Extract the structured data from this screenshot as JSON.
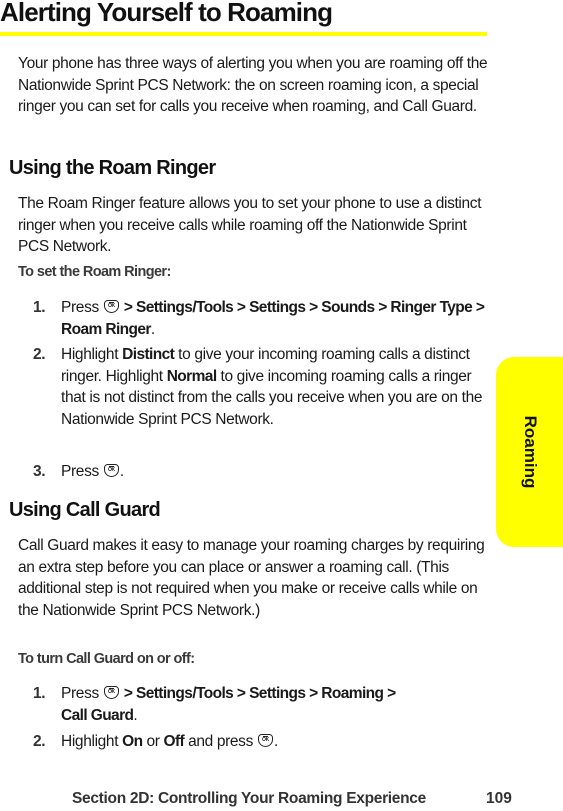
{
  "page": {
    "title": "Alerting Yourself to Roaming",
    "intro": "Your phone has three ways of alerting you when you are roaming off the Nationwide Sprint PCS Network: the on screen roaming icon, a special ringer you can set for calls you receive when roaming, and Call Guard.",
    "accent_color": "#ffff00"
  },
  "roam_ringer": {
    "heading": "Using the Roam Ringer",
    "description": "The Roam Ringer feature allows you to set your phone to use a distinct ringer when you receive calls while roaming off the Nationwide Sprint PCS Network.",
    "procedure_heading": "To set the Roam Ringer:",
    "steps": [
      {
        "number": "1.",
        "press": "Press",
        "icon": "menu-ok-key-icon",
        "path": "> Settings/Tools > Settings > Sounds > Ringer Type > Roam Ringer",
        "end": "."
      },
      {
        "number": "2.",
        "t1": "Highlight",
        "b1": "Distinct",
        "t2": "to give your incoming roaming calls a distinct ringer. Highlight",
        "b2": "Normal",
        "t3": "to give incoming roaming calls a ringer that is not distinct from the calls you receive when you are on the Nationwide Sprint PCS Network."
      },
      {
        "number": "3.",
        "press": "Press",
        "icon": "menu-ok-key-icon",
        "end": "."
      }
    ]
  },
  "call_guard": {
    "heading": "Using Call Guard",
    "description": "Call Guard makes it easy to manage your roaming charges by requiring an extra step before you can place or answer a roaming call. (This additional step is not required when you make or receive calls while on the Nationwide Sprint PCS Network.)",
    "procedure_heading": "To turn Call Guard on or off:",
    "steps": [
      {
        "number": "1.",
        "press": "Press",
        "icon": "menu-ok-key-icon",
        "path": "> Settings/Tools > Settings > Roaming > Call Guard",
        "end": "."
      },
      {
        "number": "2.",
        "t1": "Highlight",
        "b1": "On",
        "t2": "or",
        "b2": "Off",
        "t3": "and press",
        "icon": "menu-ok-key-icon",
        "end": "."
      }
    ]
  },
  "side_tab": {
    "label": "Roaming"
  },
  "footer": {
    "section": "Section 2D: Controlling Your Roaming Experience",
    "page_number": "109"
  }
}
